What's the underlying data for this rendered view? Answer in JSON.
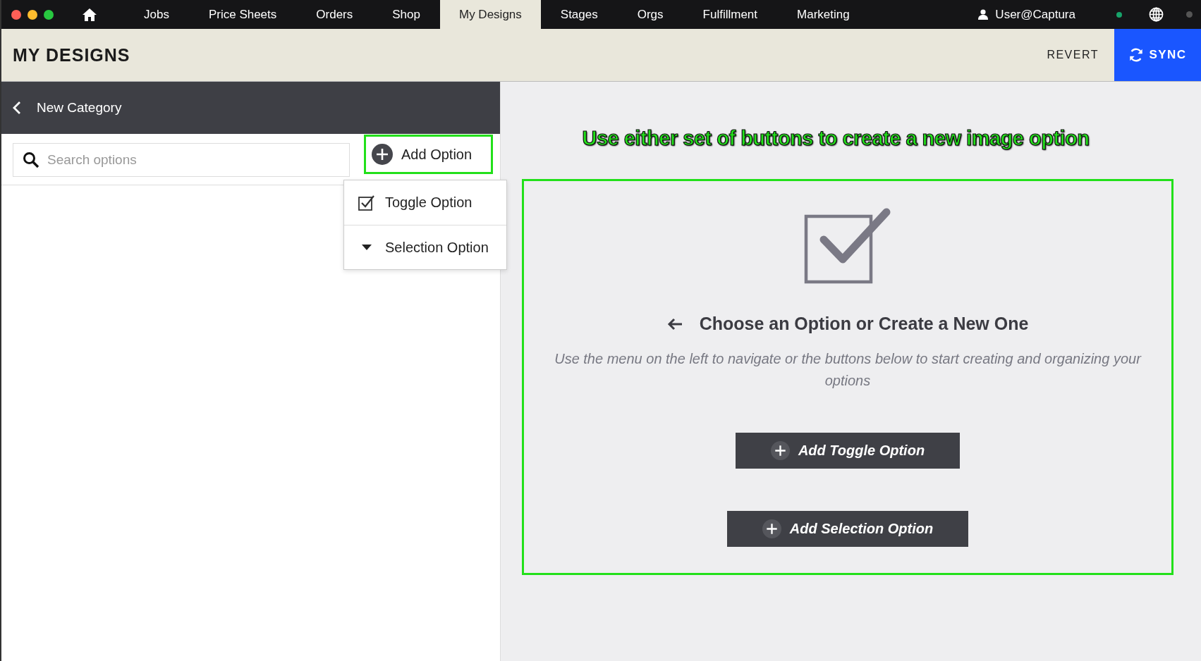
{
  "nav": {
    "tabs": [
      {
        "label": "Jobs",
        "selected": false
      },
      {
        "label": "Price Sheets",
        "selected": false
      },
      {
        "label": "Orders",
        "selected": false
      },
      {
        "label": "Shop",
        "selected": false
      },
      {
        "label": "My Designs",
        "selected": true
      },
      {
        "label": "Stages",
        "selected": false
      },
      {
        "label": "Orgs",
        "selected": false
      },
      {
        "label": "Fulfillment",
        "selected": false
      },
      {
        "label": "Marketing",
        "selected": false
      }
    ],
    "user": "User@Captura"
  },
  "header": {
    "title": "MY DESIGNS",
    "revert": "REVERT",
    "sync": "SYNC"
  },
  "sidebar": {
    "title": "New Category",
    "search": {
      "placeholder": "Search options"
    },
    "add_option": {
      "label": "Add Option",
      "highlighted": true
    },
    "menu": [
      {
        "kind": "toggle",
        "label": "Toggle Option"
      },
      {
        "kind": "selection",
        "label": "Selection Option"
      }
    ]
  },
  "annotation": "Use either set of buttons to create a new image option",
  "empty_state": {
    "highlighted": true,
    "heading": "Choose an Option or Create a New One",
    "text": "Use the menu on the left to navigate or the buttons below to start creating and organizing your options",
    "buttons": [
      "Add Toggle Option",
      "Add Selection Option"
    ]
  }
}
